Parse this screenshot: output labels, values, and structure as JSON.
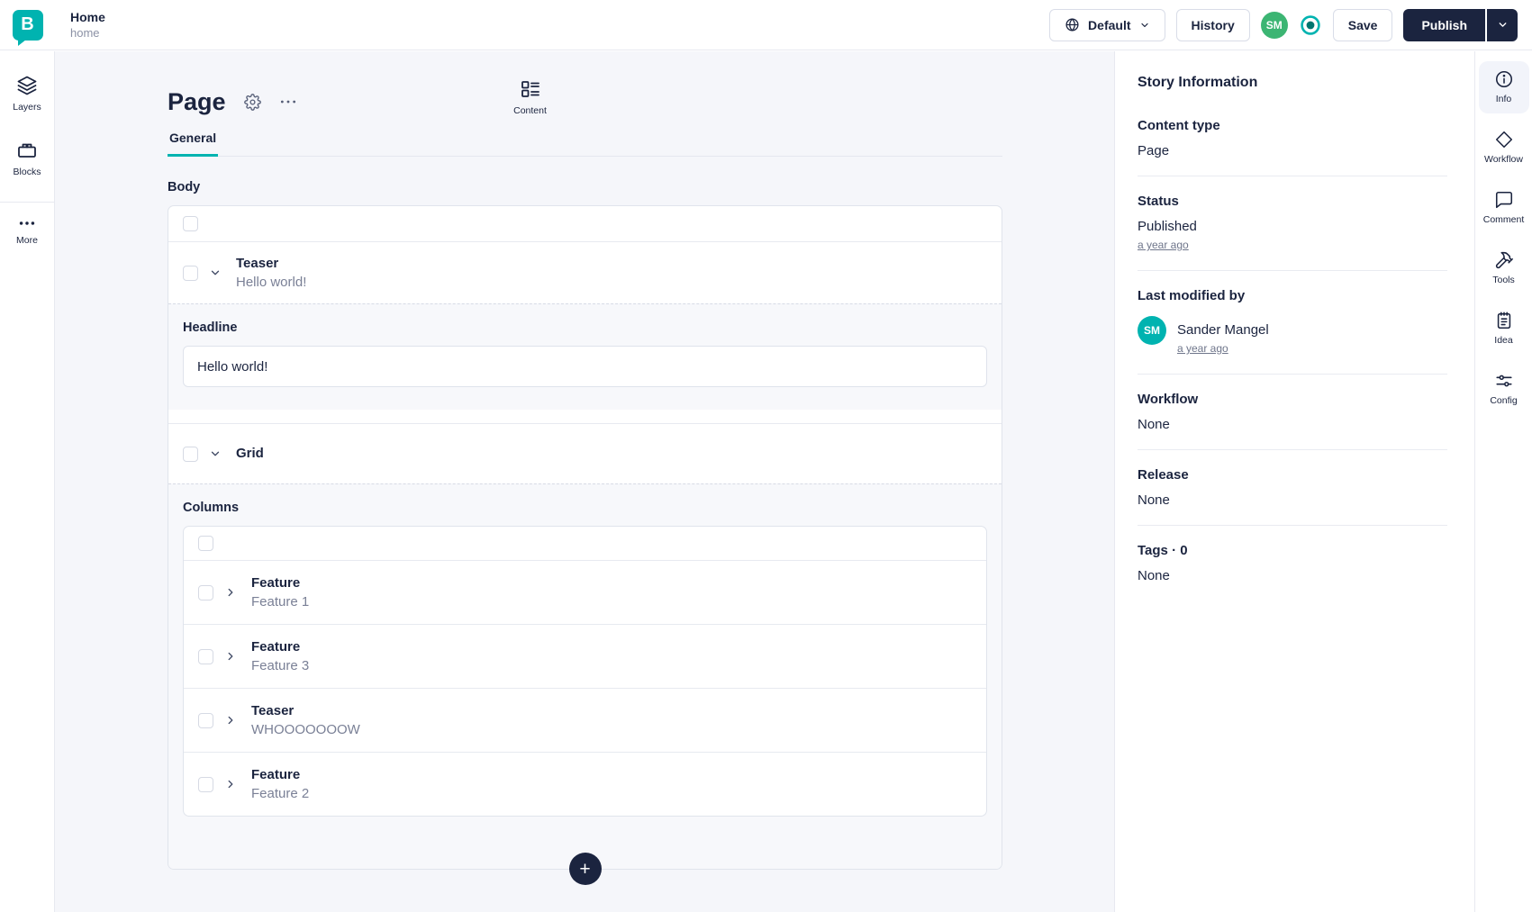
{
  "colors": {
    "accent_teal": "#00b3b0",
    "brand_navy": "#1b243f",
    "avatar_green": "#3cb573",
    "page_background": "#f5f6fa"
  },
  "topbar": {
    "logo_letter": "B",
    "story_title": "Home",
    "story_slug": "home",
    "language_label": "Default",
    "history_label": "History",
    "avatar_initials": "SM",
    "save_label": "Save",
    "publish_label": "Publish"
  },
  "left_rail": {
    "items": [
      {
        "label": "Layers",
        "icon": "layers-icon"
      },
      {
        "label": "Content",
        "icon": "content-icon"
      },
      {
        "label": "Blocks",
        "icon": "blocks-icon"
      },
      {
        "label": "More",
        "icon": "more-dots-icon"
      }
    ]
  },
  "editor": {
    "page_title": "Page",
    "tab_label": "General",
    "body_field_label": "Body",
    "teaser_block": {
      "title": "Teaser",
      "subtitle": "Hello world!"
    },
    "headline_field": {
      "label": "Headline",
      "value": "Hello world!"
    },
    "grid_block": {
      "title": "Grid"
    },
    "columns_field_label": "Columns",
    "column_blocks": [
      {
        "title": "Feature",
        "subtitle": "Feature 1"
      },
      {
        "title": "Feature",
        "subtitle": "Feature 3"
      },
      {
        "title": "Teaser",
        "subtitle": "WHOOOOOOOW"
      },
      {
        "title": "Feature",
        "subtitle": "Feature 2"
      }
    ],
    "add_block_label": "+"
  },
  "story_info": {
    "title": "Story Information",
    "content_type": {
      "label": "Content type",
      "value": "Page"
    },
    "status": {
      "label": "Status",
      "value": "Published",
      "time_link": "a year ago"
    },
    "last_modified": {
      "label": "Last modified by",
      "avatar_initials": "SM",
      "name": "Sander Mangel",
      "time_link": "a year ago"
    },
    "workflow": {
      "label": "Workflow",
      "value": "None"
    },
    "release": {
      "label": "Release",
      "value": "None"
    },
    "tags": {
      "label": "Tags · 0",
      "value": "None"
    }
  },
  "right_rail": {
    "items": [
      {
        "label": "Info",
        "icon": "info-icon"
      },
      {
        "label": "Workflow",
        "icon": "workflow-diamond-icon"
      },
      {
        "label": "Comment",
        "icon": "comment-bubble-icon"
      },
      {
        "label": "Tools",
        "icon": "tools-hammer-icon"
      },
      {
        "label": "Idea",
        "icon": "idea-notepad-icon"
      },
      {
        "label": "Config",
        "icon": "config-sliders-icon"
      }
    ]
  }
}
